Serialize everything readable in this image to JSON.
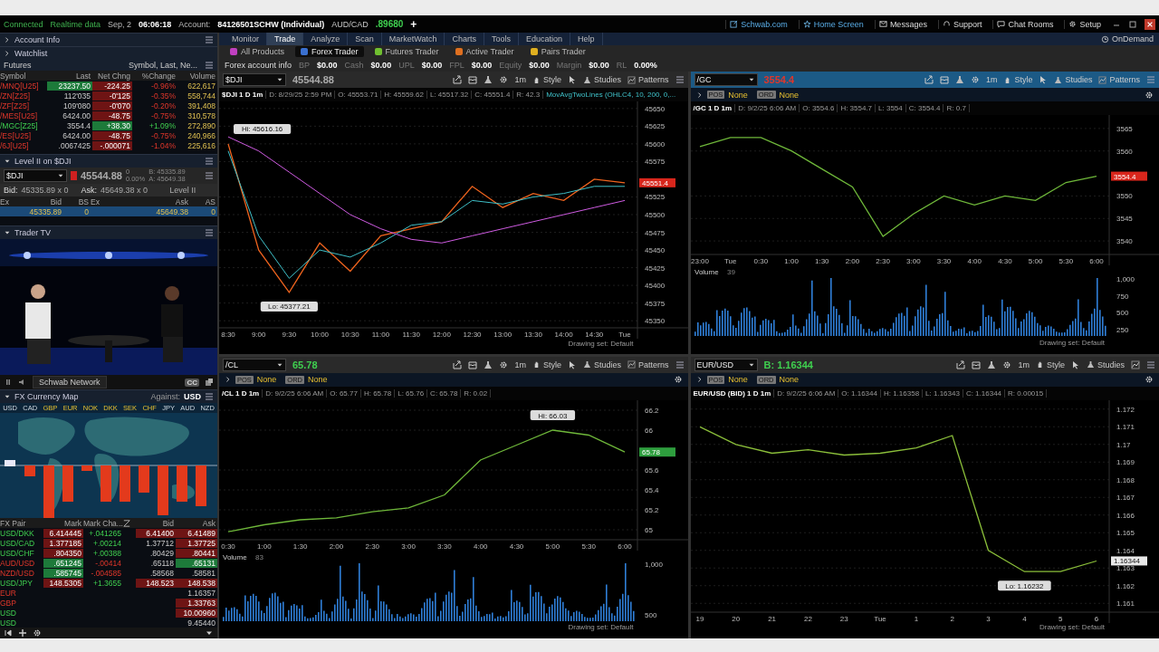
{
  "top_bar": {
    "status": [
      "Connected",
      "Realtime data"
    ],
    "date": "Sep, 2",
    "time": "06:06:18",
    "account_label": "Account:",
    "account": "84126501SCHW (Individual)",
    "pair": "AUD/CAD",
    "pair_price": ".89680",
    "add_tab": "+",
    "links": [
      {
        "label": "Schwab.com",
        "highlight": true
      },
      {
        "label": "Home Screen",
        "highlight": true
      },
      {
        "label": "Messages",
        "highlight": false
      },
      {
        "label": "Support",
        "highlight": false
      },
      {
        "label": "Chat Rooms",
        "highlight": false
      },
      {
        "label": "Setup",
        "highlight": false
      }
    ]
  },
  "menu": {
    "items": [
      {
        "label": "Monitor",
        "selected": false
      },
      {
        "label": "Trade",
        "selected": true
      },
      {
        "label": "Analyze",
        "selected": false
      },
      {
        "label": "Scan",
        "selected": false
      },
      {
        "label": "MarketWatch",
        "selected": false
      },
      {
        "label": "Charts",
        "selected": false
      },
      {
        "label": "Tools",
        "selected": false
      },
      {
        "label": "Education",
        "selected": false
      },
      {
        "label": "Help",
        "selected": false
      }
    ],
    "ondemand": "OnDemand"
  },
  "sub_tabs": [
    {
      "label": "All Products",
      "selected": false
    },
    {
      "label": "Forex Trader",
      "selected": true
    },
    {
      "label": "Futures Trader",
      "selected": false
    },
    {
      "label": "Active Trader",
      "selected": false
    },
    {
      "label": "Pairs Trader",
      "selected": false
    }
  ],
  "account_row": {
    "title": "Forex account info",
    "fields": [
      {
        "label": "BP",
        "value": "$0.00"
      },
      {
        "label": "Cash",
        "value": "$0.00"
      },
      {
        "label": "UPL",
        "value": "$0.00"
      },
      {
        "label": "FPL",
        "value": "$0.00"
      },
      {
        "label": "Equity",
        "value": "$0.00"
      },
      {
        "label": "Margin",
        "value": "$0.00"
      },
      {
        "label": "RL",
        "value": "0.00%"
      }
    ]
  },
  "sidebar": {
    "account_info": {
      "title": "Account Info"
    },
    "watchlist": {
      "title": "Watchlist",
      "list": "Futures",
      "columns_label": "Symbol, Last, Ne...",
      "columns": [
        "Symbol",
        "Last",
        "Net Chng",
        "%Change",
        "Volume"
      ],
      "rows": [
        {
          "symbol": "/MNQ[U25]",
          "up": false,
          "last": "23237.50",
          "last_flash": true,
          "change": "-224.25",
          "pct": "-0.96%",
          "volume": "622,617"
        },
        {
          "symbol": "/ZN[Z25]",
          "up": false,
          "last": "112'035",
          "last_flash": false,
          "change": "-0'125",
          "pct": "-0.35%",
          "volume": "558,744"
        },
        {
          "symbol": "/ZF[Z25]",
          "up": false,
          "last": "109'080",
          "last_flash": false,
          "change": "-0'070",
          "pct": "-0.20%",
          "volume": "391,408"
        },
        {
          "symbol": "/MES[U25]",
          "up": false,
          "last": "6424.00",
          "last_flash": false,
          "change": "-48.75",
          "pct": "-0.75%",
          "volume": "310,578"
        },
        {
          "symbol": "/MGC[Z25]",
          "up": true,
          "last": "3554.4",
          "last_flash": false,
          "change": "+38.30",
          "pct": "+1.09%",
          "volume": "272,890"
        },
        {
          "symbol": "/ES[U25]",
          "up": false,
          "last": "6424.00",
          "last_flash": false,
          "change": "-48.75",
          "pct": "-0.75%",
          "volume": "240,966"
        },
        {
          "symbol": "/6J[U25]",
          "up": false,
          "last": ".0067425",
          "last_flash": false,
          "change": "-.000071",
          "pct": "-1.04%",
          "volume": "225,616"
        }
      ]
    },
    "level2": {
      "title": "Level II on $DJI",
      "symbol": "$DJI",
      "price": "45544.88",
      "change": "0",
      "pct": "0.00%",
      "bid_quote": "B: 45335.89",
      "ask_quote": "A: 45649.38",
      "bid_label": "Bid:",
      "bid": "45335.89 x 0",
      "ask_label": "Ask:",
      "ask": "45649.38 x 0",
      "mode": "Level II",
      "columns": [
        "Ex",
        "Bid",
        "BS",
        "Ex",
        "Ask",
        "AS"
      ],
      "rows": [
        {
          "bid": "45335.89",
          "bs": "0",
          "ask": "45649.38",
          "as": "0"
        }
      ]
    },
    "trader_tv": {
      "title": "Trader TV",
      "channel": "Schwab Network",
      "cc": "CC"
    },
    "fx_map": {
      "title": "FX Currency Map",
      "against_label": "Against:",
      "against": "USD",
      "currencies": [
        {
          "code": "USD",
          "highlight": false
        },
        {
          "code": "CAD",
          "highlight": false
        },
        {
          "code": "GBP",
          "highlight": true
        },
        {
          "code": "EUR",
          "highlight": true
        },
        {
          "code": "NOK",
          "highlight": true
        },
        {
          "code": "DKK",
          "highlight": true
        },
        {
          "code": "SEK",
          "highlight": true
        },
        {
          "code": "CHF",
          "highlight": true
        },
        {
          "code": "JPY",
          "highlight": false
        },
        {
          "code": "AUD",
          "highlight": false
        },
        {
          "code": "NZD",
          "highlight": false
        }
      ]
    },
    "fx_table": {
      "columns": [
        "FX Pair",
        "Mark",
        "Mark Cha..."
      ],
      "columns_right": [
        "Bid",
        "Ask"
      ],
      "rows": [
        {
          "pair": "USD/DKK",
          "up": true,
          "mark": "6.414445",
          "mark_flash": true,
          "change": "+.041265",
          "bid": "6.41400",
          "bid_flash": true,
          "ask": "6.41489",
          "ask_flash": true,
          "ask_rising": false
        },
        {
          "pair": "USD/CAD",
          "up": true,
          "mark": "1.377185",
          "mark_flash": true,
          "change": "+.00214",
          "bid": "1.37712",
          "bid_flash": false,
          "ask": "1.37725",
          "ask_flash": true,
          "ask_rising": false
        },
        {
          "pair": "USD/CHF",
          "up": true,
          "mark": ".804350",
          "mark_flash": true,
          "change": "+.00388",
          "bid": ".80429",
          "bid_flash": false,
          "ask": ".80441",
          "ask_flash": true,
          "ask_rising": false
        },
        {
          "pair": "AUD/USD",
          "up": false,
          "mark": ".651245",
          "mark_flash": true,
          "change": "-.00414",
          "bid": ".65118",
          "bid_flash": false,
          "ask": ".65131",
          "ask_flash": true,
          "ask_rising": true
        },
        {
          "pair": "NZD/USD",
          "up": false,
          "mark": ".585745",
          "mark_flash": true,
          "change": "-.004585",
          "bid": ".58568",
          "bid_flash": false,
          "ask": ".58581",
          "ask_flash": false,
          "ask_rising": false
        },
        {
          "pair": "USD/JPY",
          "up": true,
          "mark": "148.5305",
          "mark_flash": true,
          "change": "+1.3655",
          "bid": "148.523",
          "bid_flash": true,
          "ask": "148.538",
          "ask_flash": true,
          "ask_rising": false
        },
        {
          "pair": "EUR",
          "up": false,
          "ask": "1.16357",
          "ask_flash": false,
          "ask_rising": false
        },
        {
          "pair": "GBP",
          "up": false,
          "ask": "1.33763",
          "ask_flash": true,
          "ask_rising": false
        },
        {
          "pair": "USD",
          "up": true,
          "ask": "10.00960",
          "ask_flash": true,
          "ask_rising": false
        },
        {
          "pair": "USD",
          "up": true,
          "ask": "9.45440",
          "ask_flash": false,
          "ask_rising": false
        }
      ]
    }
  },
  "charts": [
    {
      "symbol": "$DJI",
      "selected": false,
      "rising": false,
      "falling": false,
      "price": "45544.88",
      "tools": [
        "1m",
        "Style",
        "Studies",
        "Patterns"
      ],
      "title": "$DJI 1 D 1m",
      "info": [
        "D: 8/29/25 2:59 PM",
        "O: 45553.71",
        "H: 45559.62",
        "L: 45517.32",
        "C: 45551.4",
        "R: 42.3"
      ],
      "study": "MovAvgTwoLines (OHLC4, 10, 200, 0,...",
      "drawing_set": "Drawing set: Default",
      "last_tag": {
        "text": "45551.4",
        "rising": false,
        "falling": true
      },
      "chart_data": {
        "type": "line",
        "grid": true,
        "categories": [
          "8:30",
          "9:00",
          "9:30",
          "10:00",
          "10:30",
          "11:00",
          "11:30",
          "12:00",
          "12:30",
          "13:00",
          "13:30",
          "14:00",
          "14:30",
          "Tue"
        ],
        "ylim": [
          45340,
          45660
        ],
        "yticks": [
          45650,
          45625,
          45600,
          45575,
          45525,
          45500,
          45475,
          45450,
          45425,
          45400,
          45375,
          45350
        ],
        "series": [
          {
            "color": "#f0641e",
            "values": [
              45600,
              45450,
              45390,
              45460,
              45420,
              45470,
              45480,
              45490,
              45540,
              45510,
              45530,
              45520,
              45550,
              45545
            ]
          },
          {
            "color": "#3fc1c9",
            "values": [
              45590,
              45470,
              45410,
              45450,
              45440,
              45460,
              45485,
              45490,
              45520,
              45515,
              45525,
              45530,
              45540,
              45540
            ]
          },
          {
            "color": "#d05ce3",
            "values": [
              45610,
              45590,
              45560,
              45530,
              45500,
              45480,
              45465,
              45460,
              45470,
              45480,
              45490,
              45500,
              45510,
              45520
            ]
          }
        ],
        "annotations": [
          {
            "text": "Hi: 45616.16",
            "x": "8:30",
            "y": 45600
          },
          {
            "text": "Lo: 45377.21",
            "x": "9:30",
            "y": 45390
          }
        ]
      }
    },
    {
      "symbol": "/GC",
      "selected": true,
      "rising": false,
      "falling": true,
      "price": "3554.4",
      "tools": [
        "1m",
        "Style",
        "Studies",
        "Patterns"
      ],
      "pos_label": "POS",
      "pos": "None",
      "ord_label": "ORD",
      "ord": "None",
      "title": "/GC 1 D 1m",
      "info": [
        "D: 9/2/25 6:06 AM",
        "O: 3554.6",
        "H: 3554.7",
        "L: 3554",
        "C: 3554.4",
        "R: 0.7"
      ],
      "drawing_set": "Drawing set: Default",
      "last_tag": {
        "text": "3554.4",
        "rising": false,
        "falling": true
      },
      "volume": {
        "label": "Volume",
        "reading": "39",
        "ticks": [
          "1,000",
          "750",
          "500",
          "250"
        ]
      },
      "chart_data": {
        "type": "line",
        "grid": true,
        "categories": [
          "23:00",
          "Tue",
          "0:30",
          "1:00",
          "1:30",
          "2:00",
          "2:30",
          "3:00",
          "3:30",
          "4:00",
          "4:30",
          "5:00",
          "5:30",
          "6:00"
        ],
        "ylim": [
          3537,
          3568
        ],
        "yticks": [
          3565,
          3560,
          3550,
          3545,
          3540
        ],
        "series": [
          {
            "color": "#6fb83a",
            "values": [
              3561,
              3563,
              3563,
              3560,
              3556,
              3552,
              3541,
              3546,
              3550,
              3548,
              3550,
              3549,
              3553,
              3554.4
            ]
          }
        ]
      }
    },
    {
      "symbol": "/CL",
      "selected": false,
      "rising": true,
      "falling": false,
      "price": "65.78",
      "tools": [
        "1m",
        "Style",
        "Studies",
        "Patterns"
      ],
      "pos_label": "POS",
      "pos": "None",
      "ord_label": "ORD",
      "ord": "None",
      "title": "/CL 1 D 1m",
      "info": [
        "D: 9/2/25 6:06 AM",
        "O: 65.77",
        "H: 65.78",
        "L: 65.76",
        "C: 65.78",
        "R: 0.02"
      ],
      "drawing_set": "Drawing set: Default",
      "last_tag": {
        "text": "65.78",
        "rising": true,
        "falling": false
      },
      "volume": {
        "label": "Volume",
        "reading": "83",
        "ticks": [
          "1,000",
          "500"
        ]
      },
      "chart_data": {
        "type": "line",
        "grid": true,
        "categories": [
          "0:30",
          "1:00",
          "1:30",
          "2:00",
          "2:30",
          "3:00",
          "3:30",
          "4:00",
          "4:30",
          "5:00",
          "5:30",
          "6:00"
        ],
        "ylim": [
          64.9,
          66.3
        ],
        "yticks": [
          66.2,
          66,
          65.6,
          65.4,
          65.2,
          65
        ],
        "series": [
          {
            "color": "#6fb83a",
            "values": [
              64.98,
              65.05,
              65.1,
              65.12,
              65.18,
              65.22,
              65.35,
              65.7,
              65.85,
              66.0,
              65.95,
              65.78
            ]
          }
        ],
        "annotations": [
          {
            "text": "Hi: 66.03",
            "x": "5:00",
            "y": 66.0
          }
        ]
      }
    },
    {
      "symbol": "EUR/USD",
      "selected": false,
      "rising": true,
      "falling": false,
      "price": "B: 1.16344",
      "tools": [
        "1m",
        "Style",
        "Studies"
      ],
      "pos_label": "POS",
      "pos": "None",
      "ord_label": "ORD",
      "ord": "None",
      "title": "EUR/USD (BID) 1 D 1m",
      "info": [
        "D: 9/2/25 6:06 AM",
        "O: 1.16344",
        "H: 1.16358",
        "L: 1.16343",
        "C: 1.16344",
        "R: 0.00015"
      ],
      "drawing_set": "Drawing set: Default",
      "last_tag": {
        "text": "1.16344",
        "rising": false,
        "falling": false
      },
      "chart_data": {
        "type": "line",
        "grid": true,
        "categories": [
          "19",
          "20",
          "21",
          "22",
          "23",
          "Tue",
          "1",
          "2",
          "3",
          "4",
          "5",
          "6"
        ],
        "ylim": [
          1.1605,
          1.1725
        ],
        "yticks": [
          1.172,
          1.171,
          1.17,
          1.169,
          1.168,
          1.167,
          1.166,
          1.165,
          1.164,
          1.163,
          1.162,
          1.161
        ],
        "series": [
          {
            "color": "#8bbf3a",
            "values": [
              1.171,
              1.17,
              1.1695,
              1.1697,
              1.1694,
              1.1695,
              1.1698,
              1.1705,
              1.164,
              1.1628,
              1.1628,
              1.1634
            ]
          }
        ],
        "annotations": [
          {
            "text": "Lo: 1.16232",
            "x": "4",
            "y": 1.1628
          }
        ]
      }
    }
  ]
}
